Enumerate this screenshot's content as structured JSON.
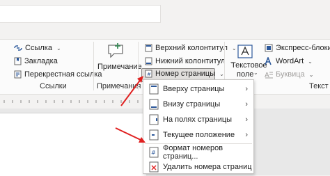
{
  "ribbon": {
    "links": {
      "items": [
        {
          "label": "Ссылка"
        },
        {
          "label": "Закладка"
        },
        {
          "label": "Перекрестная ссылка"
        }
      ],
      "group_label": "Ссылки"
    },
    "comments": {
      "label": "Примечание",
      "group_label": "Примечания"
    },
    "header_footer": {
      "items": [
        {
          "label": "Верхний колонтитул"
        },
        {
          "label": "Нижний колонтитул"
        },
        {
          "label": "Номер страницы"
        }
      ]
    },
    "text": {
      "textbox_label_1": "Текстовое",
      "textbox_label_2": "поле",
      "express_blocks": "Экспресс-блоки",
      "wordart": "WordArt",
      "dropcap": "Буквица",
      "group_label": "Текст"
    }
  },
  "menu": {
    "items": [
      {
        "label": "Вверху страницы",
        "has_submenu": true
      },
      {
        "label": "Внизу страницы",
        "has_submenu": true
      },
      {
        "label": "На полях страницы",
        "has_submenu": true
      },
      {
        "label": "Текущее положение",
        "has_submenu": true
      },
      {
        "label": "Формат номеров страниц...",
        "has_submenu": false
      },
      {
        "label": "Удалить номера страниц",
        "has_submenu": false
      }
    ]
  },
  "colors": {
    "accent": "#2b579a",
    "arrow_red": "#e02020",
    "comment_green": "#3c8c5a"
  }
}
